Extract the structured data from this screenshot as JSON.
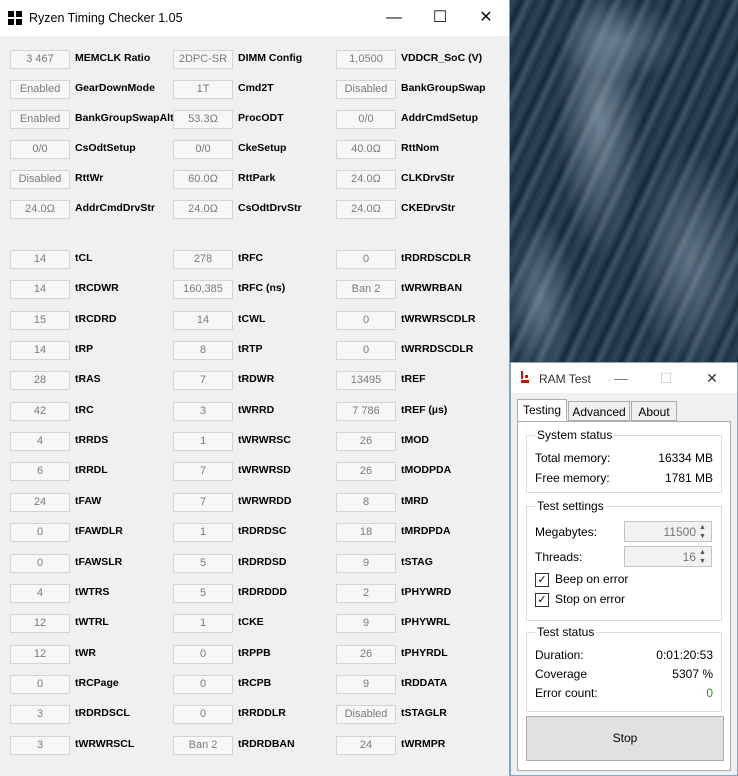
{
  "rtc": {
    "title": "Ryzen Timing Checker 1.05",
    "buttons": {
      "minimize": "—",
      "maximize": "☐",
      "close": "✕"
    },
    "col1": [
      {
        "value": "3 467",
        "label": "MEMCLK Ratio"
      },
      {
        "value": "Enabled",
        "label": "GearDownMode"
      },
      {
        "value": "Enabled",
        "label": "BankGroupSwapAlt"
      },
      {
        "value": "0/0",
        "label": "CsOdtSetup"
      },
      {
        "value": "Disabled",
        "label": "RttWr"
      },
      {
        "value": "24.0Ω",
        "label": "AddrCmdDrvStr"
      },
      null,
      {
        "value": "14",
        "label": "tCL"
      },
      {
        "value": "14",
        "label": "tRCDWR"
      },
      {
        "value": "15",
        "label": "tRCDRD"
      },
      {
        "value": "14",
        "label": "tRP"
      },
      {
        "value": "28",
        "label": "tRAS"
      },
      {
        "value": "42",
        "label": "tRC"
      },
      {
        "value": "4",
        "label": "tRRDS"
      },
      {
        "value": "6",
        "label": "tRRDL"
      },
      {
        "value": "24",
        "label": "tFAW"
      },
      {
        "value": "0",
        "label": "tFAWDLR"
      },
      {
        "value": "0",
        "label": "tFAWSLR"
      },
      {
        "value": "4",
        "label": "tWTRS"
      },
      {
        "value": "12",
        "label": "tWTRL"
      },
      {
        "value": "12",
        "label": "tWR"
      },
      {
        "value": "0",
        "label": "tRCPage"
      },
      {
        "value": "3",
        "label": "tRDRDSCL"
      },
      {
        "value": "3",
        "label": "tWRWRSCL"
      }
    ],
    "col2": [
      {
        "value": "2DPC-SR",
        "label": "DIMM Config"
      },
      {
        "value": "1T",
        "label": "Cmd2T"
      },
      {
        "value": "53.3Ω",
        "label": "ProcODT"
      },
      {
        "value": "0/0",
        "label": "CkeSetup"
      },
      {
        "value": "60.0Ω",
        "label": "RttPark"
      },
      {
        "value": "24.0Ω",
        "label": "CsOdtDrvStr"
      },
      null,
      {
        "value": "278",
        "label": "tRFC"
      },
      {
        "value": "160,385",
        "label": "tRFC (ns)"
      },
      {
        "value": "14",
        "label": "tCWL"
      },
      {
        "value": "8",
        "label": "tRTP"
      },
      {
        "value": "7",
        "label": "tRDWR"
      },
      {
        "value": "3",
        "label": "tWRRD"
      },
      {
        "value": "1",
        "label": "tWRWRSC"
      },
      {
        "value": "7",
        "label": "tWRWRSD"
      },
      {
        "value": "7",
        "label": "tWRWRDD"
      },
      {
        "value": "1",
        "label": "tRDRDSC"
      },
      {
        "value": "5",
        "label": "tRDRDSD"
      },
      {
        "value": "5",
        "label": "tRDRDDD"
      },
      {
        "value": "1",
        "label": "tCKE"
      },
      {
        "value": "0",
        "label": "tRPPB"
      },
      {
        "value": "0",
        "label": "tRCPB"
      },
      {
        "value": "0",
        "label": "tRRDDLR"
      },
      {
        "value": "Ban 2",
        "label": "tRDRDBAN"
      }
    ],
    "col3": [
      {
        "value": "1,0500",
        "label": "VDDCR_SoC (V)"
      },
      {
        "value": "Disabled",
        "label": "BankGroupSwap"
      },
      {
        "value": "0/0",
        "label": "AddrCmdSetup"
      },
      {
        "value": "40.0Ω",
        "label": "RttNom"
      },
      {
        "value": "24.0Ω",
        "label": "CLKDrvStr"
      },
      {
        "value": "24.0Ω",
        "label": "CKEDrvStr"
      },
      null,
      {
        "value": "0",
        "label": "tRDRDSCDLR"
      },
      {
        "value": "Ban 2",
        "label": "tWRWRBAN"
      },
      {
        "value": "0",
        "label": "tWRWRSCDLR"
      },
      {
        "value": "0",
        "label": "tWRRDSCDLR"
      },
      {
        "value": "13495",
        "label": "tREF"
      },
      {
        "value": "7 786",
        "label": "tREF (µs)"
      },
      {
        "value": "26",
        "label": "tMOD"
      },
      {
        "value": "26",
        "label": "tMODPDA"
      },
      {
        "value": "8",
        "label": "tMRD"
      },
      {
        "value": "18",
        "label": "tMRDPDA"
      },
      {
        "value": "9",
        "label": "tSTAG"
      },
      {
        "value": "2",
        "label": "tPHYWRD"
      },
      {
        "value": "9",
        "label": "tPHYWRL"
      },
      {
        "value": "26",
        "label": "tPHYRDL"
      },
      {
        "value": "9",
        "label": "tRDDATA"
      },
      {
        "value": "Disabled",
        "label": "tSTAGLR"
      },
      {
        "value": "24",
        "label": "tWRMPR"
      }
    ]
  },
  "ram": {
    "title": "RAM Test",
    "buttons": {
      "minimize": "—",
      "maximize": "☐",
      "close": "✕"
    },
    "tabs": [
      "Testing",
      "Advanced",
      "About"
    ],
    "system_status": {
      "title": "System status",
      "total_label": "Total memory:",
      "total_value": "16334 MB",
      "free_label": "Free memory:",
      "free_value": "1781 MB"
    },
    "test_settings": {
      "title": "Test settings",
      "megabytes_label": "Megabytes:",
      "megabytes_value": "11500",
      "threads_label": "Threads:",
      "threads_value": "16",
      "beep_label": "Beep on error",
      "stop_label": "Stop on error"
    },
    "test_status": {
      "title": "Test status",
      "duration_label": "Duration:",
      "duration_value": "0:01:20:53",
      "coverage_label": "Coverage",
      "coverage_value": "5307 %",
      "errors_label": "Error count:",
      "errors_value": "0"
    },
    "stop_button": "Stop"
  },
  "colors": {
    "error_count": "#2e8b2e",
    "accent": "#0078d7"
  }
}
